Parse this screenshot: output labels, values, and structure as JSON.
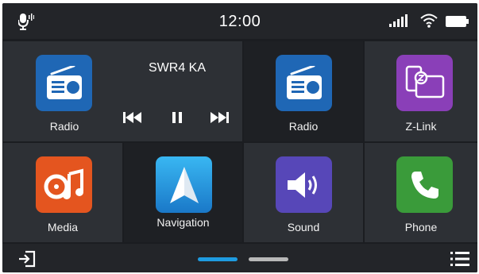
{
  "status": {
    "time": "12:00",
    "icons": [
      "voice-mic-icon",
      "signal-icon",
      "wifi-icon",
      "battery-icon"
    ]
  },
  "tiles": [
    {
      "label": "Radio",
      "icon": "radio-icon",
      "color": "#1f67b5"
    },
    {
      "label": "Radio",
      "icon": "radio-icon",
      "color": "#1f67b5"
    },
    {
      "label": "Z-Link",
      "icon": "z-link-icon",
      "color": "#8a3fb8"
    },
    {
      "label": "Media",
      "icon": "media-icon",
      "color": "#e4551f"
    },
    {
      "label": "Navigation",
      "icon": "navigation-icon",
      "color": "#1c8fd6"
    },
    {
      "label": "Sound",
      "icon": "sound-icon",
      "color": "#5747b8"
    },
    {
      "label": "Phone",
      "icon": "phone-icon",
      "color": "#3a9b3a"
    }
  ],
  "player": {
    "station": "SWR4 KA",
    "controls": [
      "previous-icon",
      "pause-icon",
      "next-icon"
    ]
  },
  "bottom": {
    "icons": [
      "exit-icon",
      "menu-icon"
    ],
    "pages": {
      "count": 2,
      "active": 1
    }
  },
  "colors": {
    "active_page": "#1e9be0",
    "inactive_page": "#b8b8b8"
  }
}
